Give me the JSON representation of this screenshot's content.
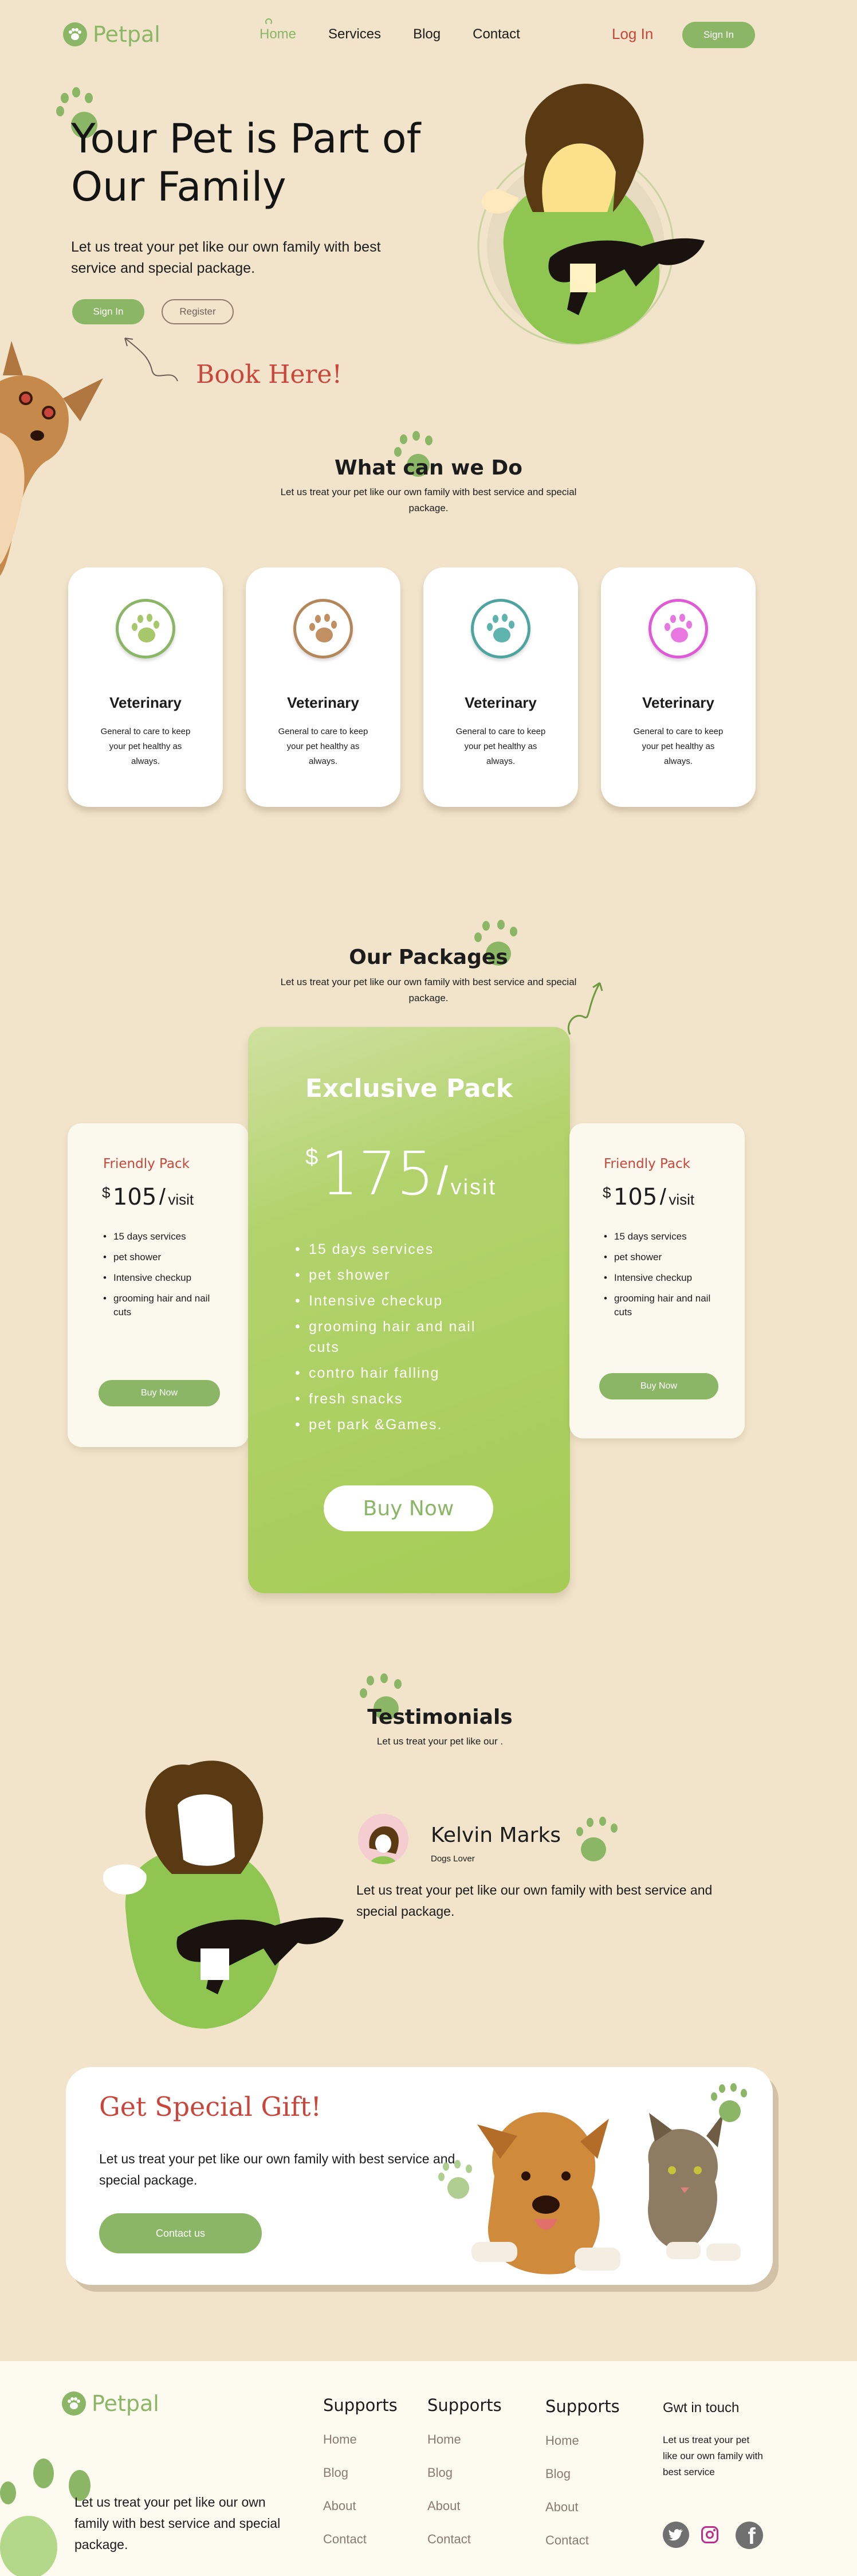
{
  "brand": {
    "name": "Petpal",
    "color": "#8bb666",
    "logo_icon": "paw-icon"
  },
  "nav": {
    "items": [
      "Home",
      "Services",
      "Blog",
      "Contact"
    ],
    "active": "Home"
  },
  "header": {
    "login_label": "Log  In",
    "signin_label": "Sign In"
  },
  "hero": {
    "title_line1": "Your Pet is Part of",
    "title_line2": "Our Family",
    "subtitle": "Let us treat your  pet like our own family with best  service and special package.",
    "signin_label": "Sign In",
    "register_label": "Register",
    "book_label": "Book  Here!"
  },
  "services": {
    "title": "What can we Do",
    "subtitle": "Let us treat your  pet like our own family with best  service and special package.",
    "cards": [
      {
        "title": "Veterinary",
        "text": "General  to care to keep your pet healthy as always.",
        "icon": "paw-icon",
        "color": "#8bb666",
        "pad": "#a6c86a"
      },
      {
        "title": "Veterinary",
        "text": "General  to care to keep your pet healthy as always.",
        "icon": "paw-icon",
        "color": "#b4875a",
        "pad": "#c09063"
      },
      {
        "title": "Veterinary",
        "text": "General  to care to keep your pet healthy as always.",
        "icon": "paw-icon",
        "color": "#4ea5a0",
        "pad": "#5eb3ae"
      },
      {
        "title": "Veterinary",
        "text": "General  to care to keep your pet healthy as always.",
        "icon": "paw-icon",
        "color": "#e05ad8",
        "pad": "#e977e2"
      }
    ]
  },
  "packages": {
    "title": "Our Packages",
    "subtitle": "Let us treat your  pet like our own family with best  service and special package.",
    "left": {
      "name": "Friendly Pack",
      "currency": "$",
      "price": "105",
      "per": "visit",
      "features": [
        "15 days services",
        "pet shower",
        "Intensive  checkup",
        "grooming hair and nail cuts"
      ],
      "button": "Buy Now"
    },
    "center": {
      "name": "Exclusive Pack",
      "currency": "$",
      "price": "175",
      "per": "visit",
      "features": [
        "15 days services",
        "pet shower",
        "Intensive  checkup",
        "grooming hair and nail cuts",
        "contro hair falling",
        "fresh snacks",
        "pet park &Games."
      ],
      "button": "Buy Now"
    },
    "right": {
      "name": "Friendly Pack",
      "currency": "$",
      "price": "105",
      "per": "visit",
      "features": [
        "15 days services",
        "pet shower",
        "Intensive  checkup",
        "grooming hair and nail cuts"
      ],
      "button": "Buy Now"
    }
  },
  "testimonials": {
    "title": "Testimonials",
    "subtitle": "Let us treat your  pet like our .",
    "name": "Kelvin Marks",
    "role": "Dogs Lover",
    "quote": "Let us treat your  pet like our own family with best  service and special package."
  },
  "gift": {
    "title": "Get Special Gift!",
    "text": "Let us treat your  pet like our own family with best  service and special package.",
    "button": "Contact us"
  },
  "footer": {
    "brand": "Petpal",
    "text": "Let us treat your  pet like our own family with best  service and special package.",
    "columns": [
      {
        "title": "Supports",
        "links": [
          "Home",
          "Blog",
          "About",
          "Contact"
        ]
      },
      {
        "title": "Supports",
        "links": [
          "Home",
          "Blog",
          "About",
          "Contact"
        ]
      },
      {
        "title": "Supports",
        "links": [
          "Home",
          "Blog",
          "About",
          "Contact"
        ]
      }
    ],
    "touch_title": "Gwt in touch",
    "touch_text": "Let us treat your  pet like our own family with best  service",
    "social": [
      "twitter-icon",
      "instagram-icon",
      "facebook-icon"
    ]
  },
  "colors": {
    "background": "#f1e4ca",
    "green": "#8bb666",
    "accent_red": "#c9463c",
    "footer_bg": "#fdfbf0"
  }
}
